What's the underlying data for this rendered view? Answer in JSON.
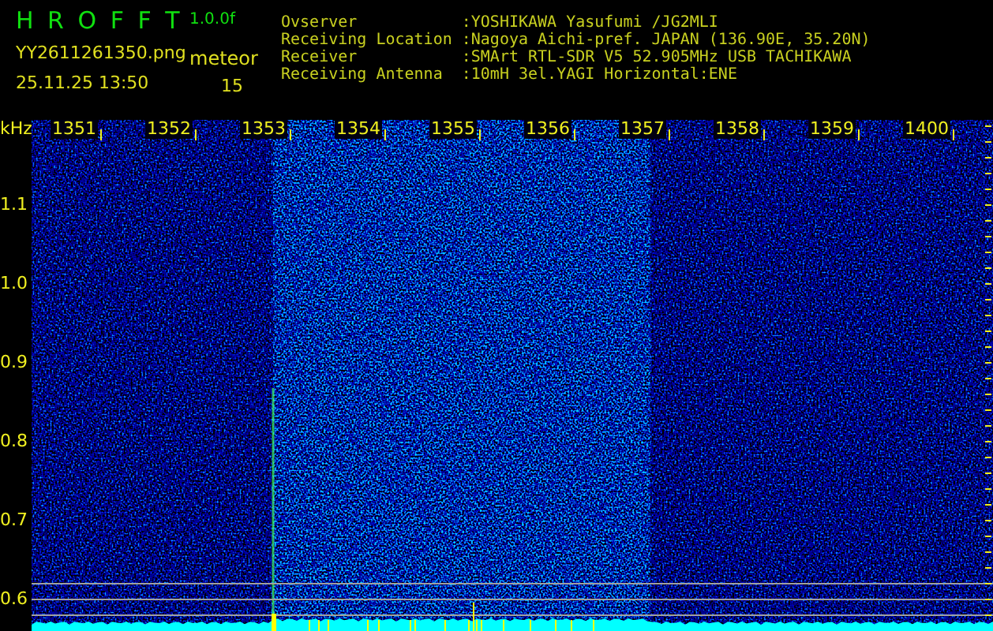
{
  "header": {
    "app_title": "H R O F F T",
    "version": "1.0.0f",
    "file_name": "YY2611261350.png",
    "mode": "meteor",
    "timestamp": "25.11.25 13:50",
    "count": "15",
    "info": [
      {
        "label": "Ovserver",
        "value": ":YOSHIKAWA Yasufumi /JG2MLI"
      },
      {
        "label": "Receiving Location",
        "value": ":Nagoya Aichi-pref. JAPAN (136.90E, 35.20N)"
      },
      {
        "label": "Receiver",
        "value": ":SMArt RTL-SDR V5 52.905MHz USB TACHIKAWA"
      },
      {
        "label": "Receiving Antenna",
        "value": ":10mH 3el.YAGI Horizontal:ENE"
      }
    ]
  },
  "frequency_axis": {
    "unit": "kHz",
    "labels": [
      "1.1",
      "1.0",
      "0.9",
      "0.8",
      "0.7",
      "0.6"
    ]
  },
  "time_axis": {
    "labels": [
      "1351",
      "1352",
      "1353",
      "1354",
      "1355",
      "1356",
      "1357",
      "1358",
      "1359",
      "1400"
    ]
  }
}
